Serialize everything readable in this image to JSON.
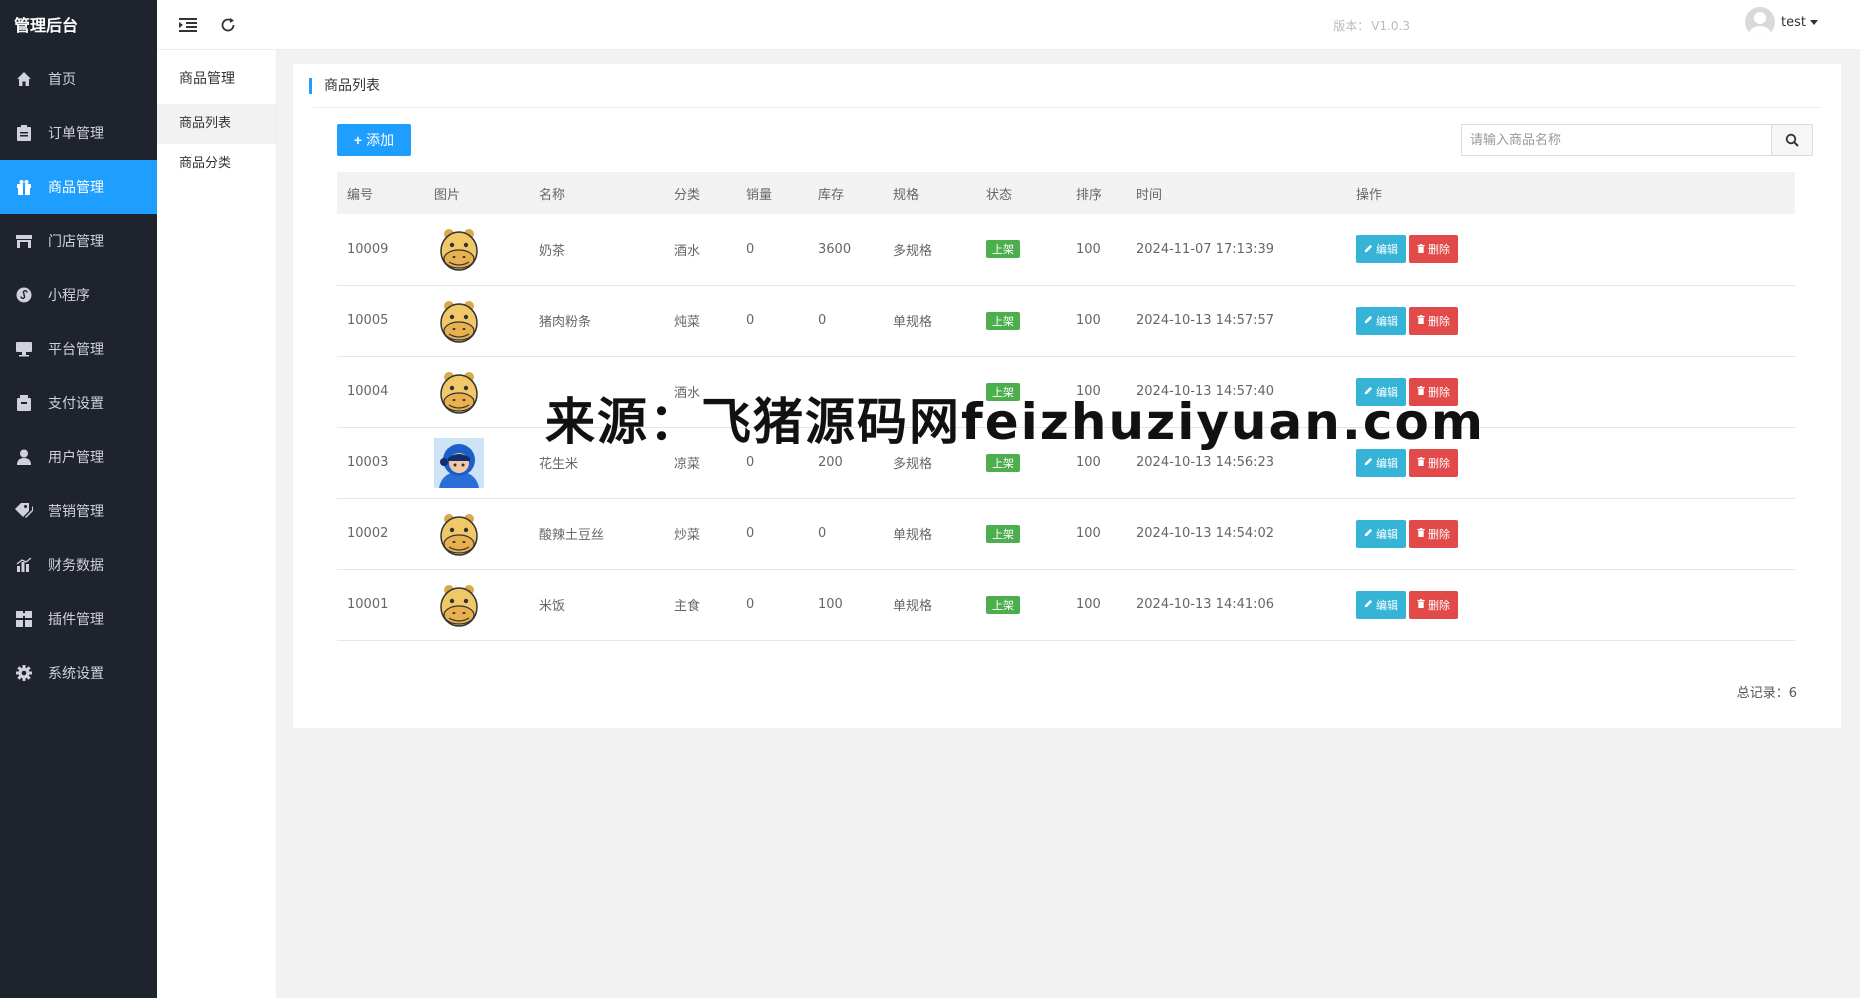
{
  "brand": "管理后台",
  "menu": [
    {
      "label": "首页",
      "icon": "home-icon"
    },
    {
      "label": "订单管理",
      "icon": "clipboard-icon"
    },
    {
      "label": "商品管理",
      "icon": "gift-icon",
      "active": true
    },
    {
      "label": "门店管理",
      "icon": "store-icon"
    },
    {
      "label": "小程序",
      "icon": "miniprogram-icon"
    },
    {
      "label": "平台管理",
      "icon": "monitor-icon"
    },
    {
      "label": "支付设置",
      "icon": "wallet-icon"
    },
    {
      "label": "用户管理",
      "icon": "user-icon"
    },
    {
      "label": "营销管理",
      "icon": "tag-icon"
    },
    {
      "label": "财务数据",
      "icon": "bar-chart-icon"
    },
    {
      "label": "插件管理",
      "icon": "puzzle-icon"
    },
    {
      "label": "系统设置",
      "icon": "gear-icon"
    }
  ],
  "submenu": {
    "title": "商品管理",
    "items": [
      {
        "label": "商品列表",
        "active": true
      },
      {
        "label": "商品分类",
        "active": false
      }
    ]
  },
  "header": {
    "version_label": "版本：",
    "version_value": "V1.0.3",
    "username": "test"
  },
  "panel": {
    "title": "商品列表",
    "add_button": "添加",
    "search_placeholder": "请输入商品名称",
    "total_label": "总记录：",
    "total_value": "6"
  },
  "table": {
    "headers": [
      "编号",
      "图片",
      "名称",
      "分类",
      "销量",
      "库存",
      "规格",
      "状态",
      "排序",
      "时间",
      "操作"
    ],
    "rows": [
      {
        "id": "10009",
        "image": "hippo",
        "name": "奶茶",
        "category": "酒水",
        "sales": "0",
        "stock": "3600",
        "spec": "多规格",
        "spec_type": "multi",
        "status": "上架",
        "sort": "100",
        "time": "2024-11-07 17:13:39"
      },
      {
        "id": "10005",
        "image": "hippo",
        "name": "猪肉粉条",
        "category": "炖菜",
        "sales": "0",
        "stock": "0",
        "spec": "单规格",
        "spec_type": "single",
        "status": "上架",
        "sort": "100",
        "time": "2024-10-13 14:57:57"
      },
      {
        "id": "10004",
        "image": "hippo",
        "name": "",
        "category": "酒水",
        "sales": "",
        "stock": "",
        "spec": "",
        "spec_type": "single",
        "status": "上架",
        "sort": "100",
        "time": "2024-10-13 14:57:40"
      },
      {
        "id": "10003",
        "image": "rider",
        "name": "花生米",
        "category": "凉菜",
        "sales": "0",
        "stock": "200",
        "spec": "多规格",
        "spec_type": "multi",
        "status": "上架",
        "sort": "100",
        "time": "2024-10-13 14:56:23"
      },
      {
        "id": "10002",
        "image": "hippo",
        "name": "酸辣土豆丝",
        "category": "炒菜",
        "sales": "0",
        "stock": "0",
        "spec": "单规格",
        "spec_type": "single",
        "status": "上架",
        "sort": "100",
        "time": "2024-10-13 14:54:02"
      },
      {
        "id": "10001",
        "image": "hippo",
        "name": "米饭",
        "category": "主食",
        "sales": "0",
        "stock": "100",
        "spec": "单规格",
        "spec_type": "single",
        "status": "上架",
        "sort": "100",
        "time": "2024-10-13 14:41:06"
      }
    ],
    "edit_label": "编辑",
    "delete_label": "删除"
  },
  "watermark": "来源：飞猪源码网feizhuziyuan.com",
  "colors": {
    "sidebar_bg": "#1f232d",
    "accent": "#1e9fff",
    "status_green": "#4cae4c",
    "edit_cyan": "#36b4d8",
    "delete_red": "#e24a4a",
    "spec_multi": "#e02020",
    "spec_single": "#3aa33a"
  }
}
